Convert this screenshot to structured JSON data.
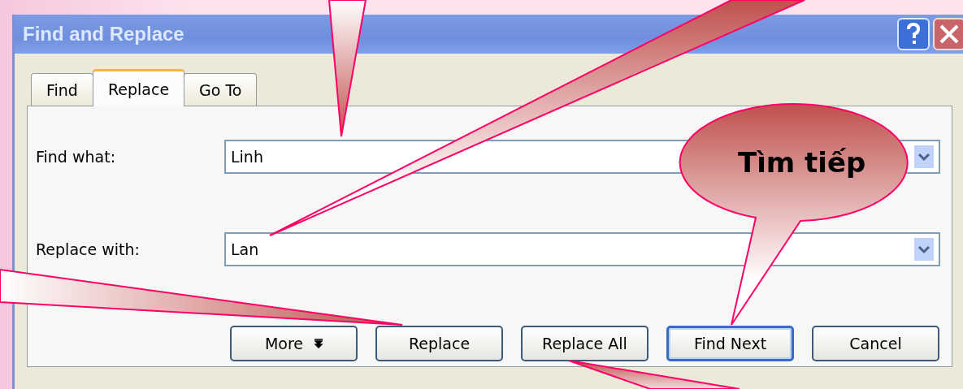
{
  "window": {
    "title": "Find and Replace"
  },
  "tabs": [
    {
      "label": "Find",
      "selected": false
    },
    {
      "label": "Replace",
      "selected": true
    },
    {
      "label": "Go To",
      "selected": false
    }
  ],
  "fields": [
    {
      "label": "Find what:",
      "value": "Linh"
    },
    {
      "label": "Replace with:",
      "value": "Lan"
    }
  ],
  "buttons": [
    {
      "label": "More",
      "kind": "expand",
      "default": false
    },
    {
      "label": "Replace",
      "kind": "plain",
      "default": false
    },
    {
      "label": "Replace All",
      "kind": "plain",
      "default": false
    },
    {
      "label": "Find Next",
      "kind": "plain",
      "default": true
    },
    {
      "label": "Cancel",
      "kind": "plain",
      "default": false
    }
  ],
  "callout": {
    "text": "Tìm tiếp"
  }
}
